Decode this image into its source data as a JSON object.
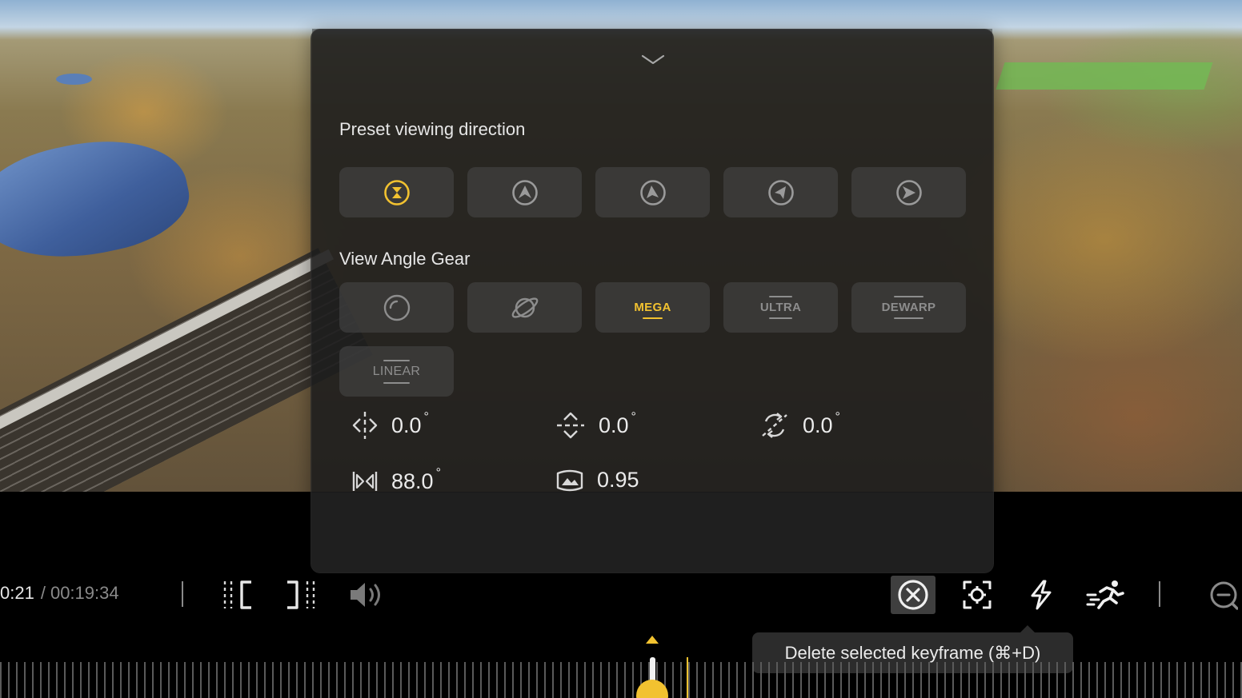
{
  "panel": {
    "preset_title": "Preset viewing direction",
    "gear_title": "View Angle Gear",
    "preset_icons": [
      "front-view-icon",
      "up-view-icon",
      "left-view-icon",
      "diagonal-view-icon",
      "right-view-icon"
    ],
    "gears": {
      "mega": "MEGA",
      "ultra": "ULTRA",
      "dewarp": "DEWARP",
      "linear": "LINEAR"
    },
    "params": {
      "pan": "0.0",
      "tilt": "0.0",
      "roll": "0.0",
      "fov": "88.0",
      "distortion": "0.95",
      "degree_symbol": "°"
    }
  },
  "toolbar": {
    "current_time": "0:21",
    "separator": "/",
    "total_time": "00:19:34",
    "tooltip": "Delete selected keyframe (⌘+D)"
  },
  "colors": {
    "accent": "#f2c230",
    "panel_bg": "#1e1e1e",
    "button_bg": "#464646",
    "text": "#ebebeb",
    "muted": "#8a8a8a"
  }
}
